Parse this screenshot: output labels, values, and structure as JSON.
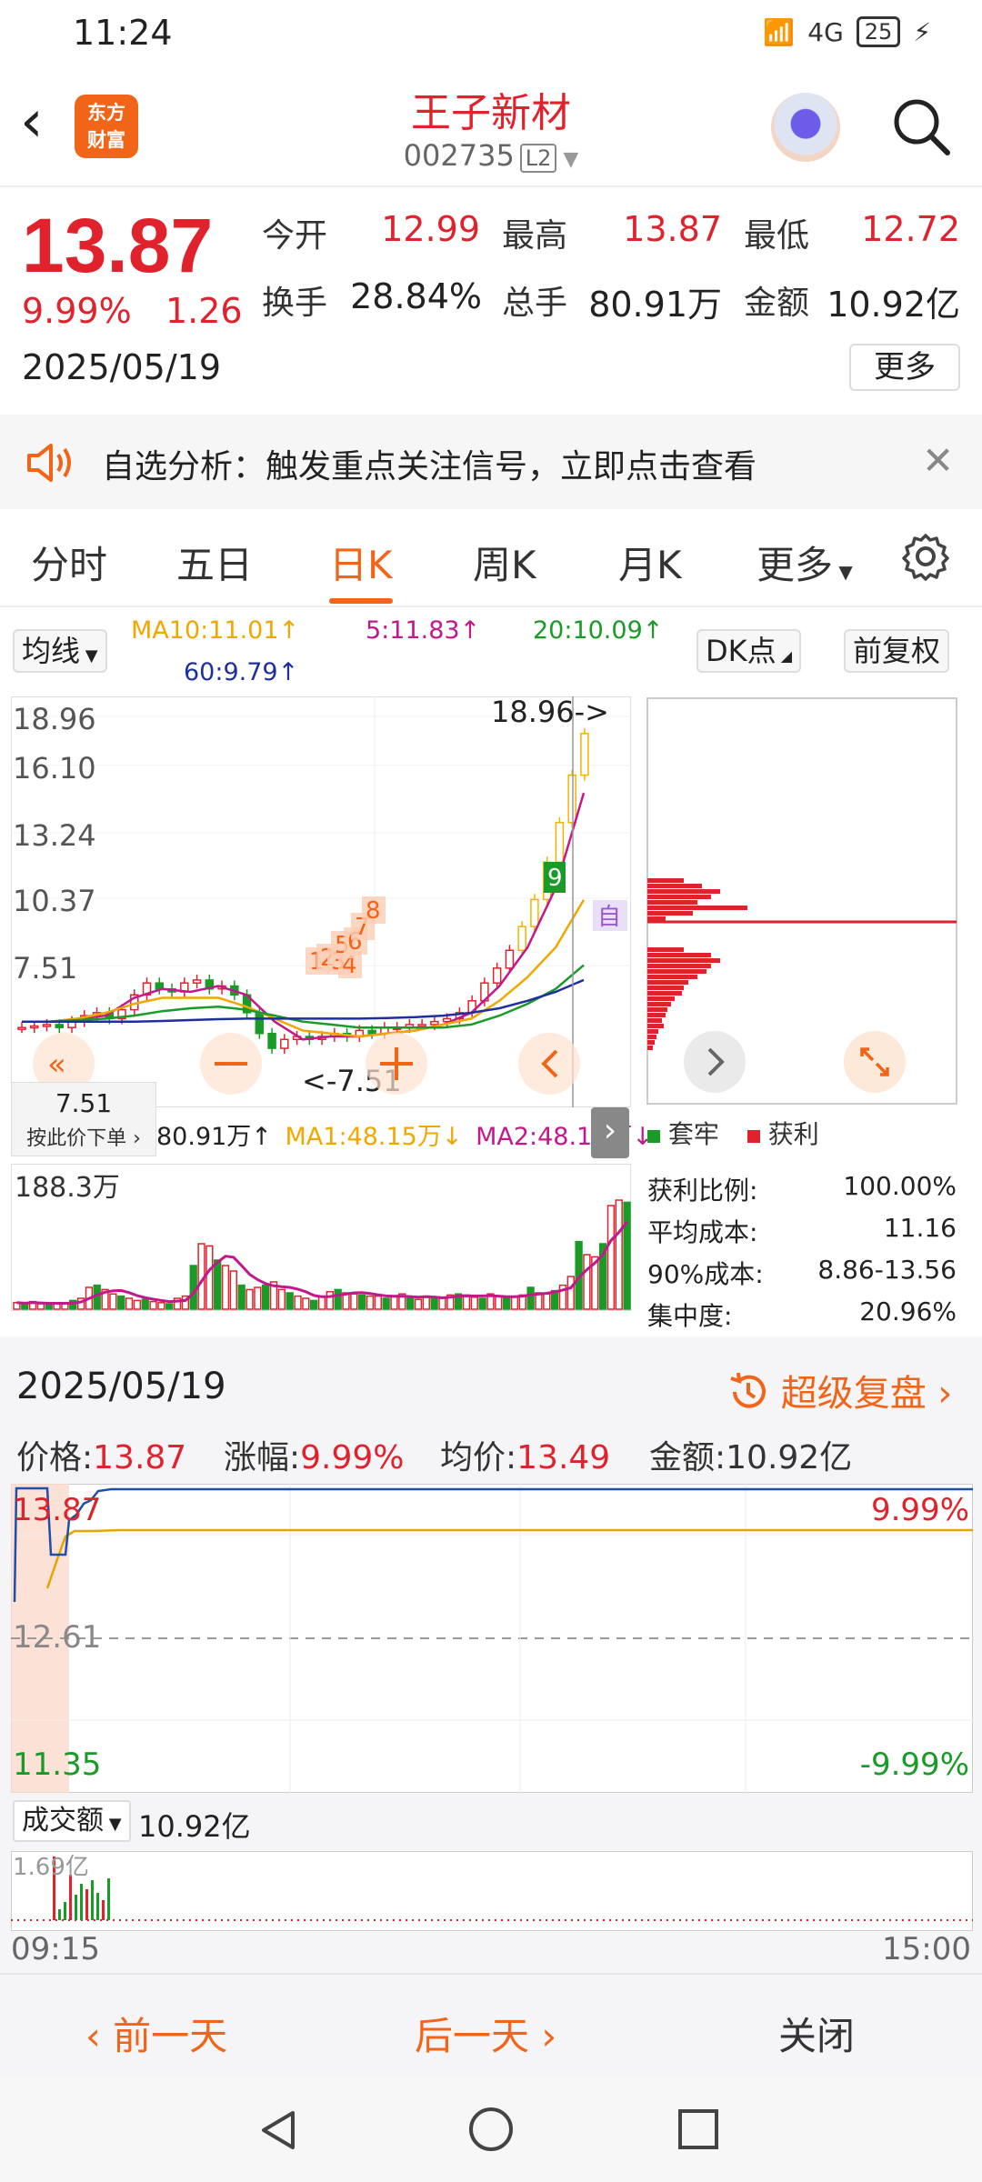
{
  "status": {
    "time": "11:24",
    "signal": "4G",
    "battery": "25"
  },
  "header": {
    "logo_line1": "东方",
    "logo_line2": "财富",
    "name": "王子新材",
    "code": "002735",
    "level": "L2"
  },
  "quote": {
    "price": "13.87",
    "change_pct": "9.99%",
    "change_amt": "1.26",
    "date": "2025/05/19",
    "open_label": "今开",
    "open": "12.99",
    "high_label": "最高",
    "high": "13.87",
    "low_label": "最低",
    "low": "12.72",
    "turnover_label": "换手",
    "turnover": "28.84%",
    "volume_label": "总手",
    "volume": "80.91万",
    "amount_label": "金额",
    "amount": "10.92亿",
    "more": "更多"
  },
  "notice": {
    "text": "自选分析：触发重点关注信号，立即点击查看"
  },
  "tabs": [
    "分时",
    "五日",
    "日K",
    "周K",
    "月K",
    "更多"
  ],
  "active_tab": "日K",
  "ma": {
    "select": "均线",
    "ma10": "MA10:11.01↑",
    "ma5": "5:11.83↑",
    "ma20": "20:10.09↑",
    "ma60": "60:9.79↑",
    "dk": "DK点",
    "adjust": "前复权",
    "color_ma5": "#c2188c",
    "color_ma10": "#f0a800",
    "color_ma20": "#1a9b28",
    "color_ma60": "#1f2f9e"
  },
  "kline": {
    "y_labels": [
      "18.96",
      "16.10",
      "13.24",
      "10.37",
      "7.51"
    ],
    "max_marker": "18.96->",
    "min_marker": "<-7.51",
    "signals": [
      "1",
      "2",
      "3",
      "4",
      "5",
      "6",
      "7",
      "8",
      "9"
    ],
    "self_tag": "自",
    "tooltip_value": "7.51",
    "tooltip_sub": "按此价下单"
  },
  "volume": {
    "legend_total": "80.91万↑",
    "legend_ma1": "MA1:48.15万↓",
    "legend_ma2": "MA2:48.15万↓",
    "max_label": "188.3万",
    "bars": [
      0.06,
      0.05,
      0.07,
      0.05,
      0.04,
      0.06,
      0.05,
      0.08,
      0.1,
      0.2,
      0.22,
      0.18,
      0.14,
      0.12,
      0.1,
      0.08,
      0.09,
      0.07,
      0.06,
      0.05,
      0.1,
      0.12,
      0.4,
      0.6,
      0.58,
      0.45,
      0.4,
      0.35,
      0.22,
      0.18,
      0.2,
      0.22,
      0.25,
      0.18,
      0.15,
      0.12,
      0.1,
      0.08,
      0.12,
      0.16,
      0.18,
      0.15,
      0.14,
      0.13,
      0.12,
      0.12,
      0.1,
      0.12,
      0.14,
      0.1,
      0.09,
      0.12,
      0.11,
      0.1,
      0.13,
      0.14,
      0.13,
      0.11,
      0.1,
      0.14,
      0.12,
      0.1,
      0.11,
      0.13,
      0.2,
      0.15,
      0.14,
      0.17,
      0.22,
      0.3,
      0.62,
      0.5,
      0.48,
      0.6,
      0.95,
      1.0,
      0.98
    ]
  },
  "chips": {
    "legend_trap": "套牢",
    "legend_profit": "获利",
    "stats": [
      {
        "label": "获利比例:",
        "value": "100.00%"
      },
      {
        "label": "平均成本:",
        "value": "11.16"
      },
      {
        "label": "90%成本:",
        "value": "8.86-13.56"
      },
      {
        "label": "集中度:",
        "value": "20.96%"
      }
    ]
  },
  "detail": {
    "date": "2025/05/19",
    "replay": "超级复盘",
    "price_label": "价格:",
    "price": "13.87",
    "pct_label": "涨幅:",
    "pct": "9.99%",
    "avg_label": "均价:",
    "avg": "13.49",
    "amt_label": "金额:",
    "amt": "10.92亿",
    "y_top": "13.87",
    "y_mid": "12.61",
    "y_bot": "11.35",
    "pct_top": "9.99%",
    "pct_bot": "-9.99%",
    "amount_select": "成交额",
    "amount_value": "10.92亿",
    "amount_max": "1.69亿",
    "t_start": "09:15",
    "t_end": "15:00"
  },
  "nav": {
    "prev": "前一天",
    "next": "后一天",
    "close": "关闭"
  }
}
